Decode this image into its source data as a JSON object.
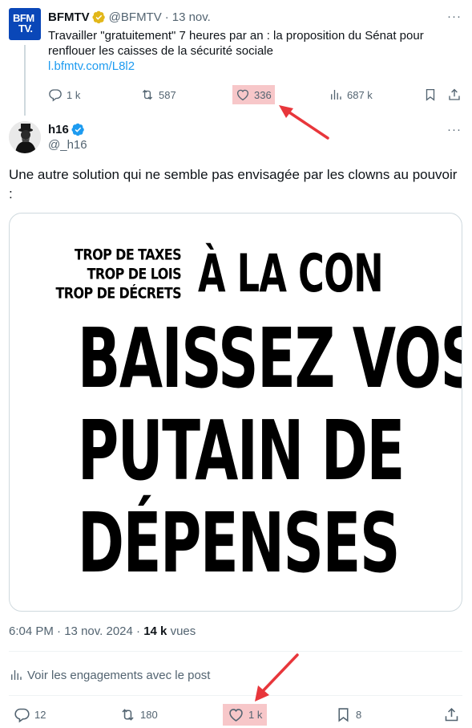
{
  "quoted_tweet": {
    "avatar_text_1": "BFM",
    "avatar_text_2": "TV.",
    "name": "BFMTV",
    "handle": "@BFMTV",
    "separator": "·",
    "time": "13 nov.",
    "text": "Travailler \"gratuitement\" 7 heures par an : la proposition du Sénat pour renflouer les caisses de la sécurité sociale",
    "link": "l.bfmtv.com/L8l2",
    "more": "···",
    "actions": {
      "replies": "1 k",
      "reposts": "587",
      "likes": "336",
      "views": "687 k"
    }
  },
  "main_tweet": {
    "name": "h16",
    "handle": "@_h16",
    "more": "···",
    "text": "Une autre solution qui ne semble pas envisagée par les clowns au pouvoir :",
    "image": {
      "small_lines": [
        "TROP DE TAXES",
        "TROP DE LOIS",
        "TROP DE DÉCRETS"
      ],
      "headline": "À LA CON",
      "big_lines": [
        "BAISSEZ VOS",
        "PUTAIN DE",
        "DÉPENSES"
      ]
    },
    "time": "6:04 PM",
    "separator": "·",
    "date": "13 nov. 2024",
    "views_count": "14 k",
    "views_label": "vues",
    "engagements_link": "Voir les engagements avec le post",
    "actions": {
      "replies": "12",
      "reposts": "180",
      "likes": "1 k",
      "bookmarks": "8"
    }
  },
  "colors": {
    "text_primary": "#0f1419",
    "text_secondary": "#536471",
    "link": "#1d9bf0",
    "verified_blue": "#1d9bf0",
    "verified_gold": "#e2b719",
    "highlight": "#f7c7c9",
    "arrow_red": "#e8363b"
  }
}
